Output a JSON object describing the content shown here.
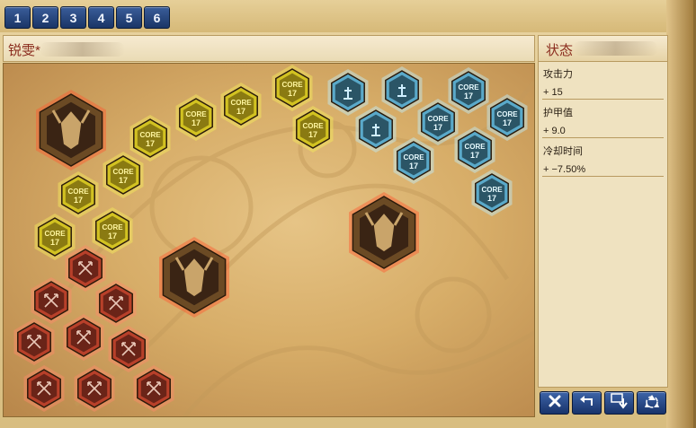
{
  "tabs": [
    "1",
    "2",
    "3",
    "4",
    "5",
    "6"
  ],
  "build": {
    "title": "锐雯*"
  },
  "stats": {
    "header": "状态",
    "items": [
      {
        "label": "攻击力",
        "value": "+ 15"
      },
      {
        "label": "护甲值",
        "value": "+ 9.0"
      },
      {
        "label": "冷却时间",
        "value": "+ −7.50%"
      }
    ]
  },
  "rune_label": {
    "line1": "CORE",
    "line2": "17"
  },
  "rune_colors": {
    "red": "#b8402a",
    "yellow": "#d2c221",
    "blue": "#5aa9c9",
    "gold": "#6b4a24"
  },
  "buttons": [
    {
      "icon": "close-x-icon"
    },
    {
      "icon": "undo-icon"
    },
    {
      "icon": "save-down-icon"
    },
    {
      "icon": "recycle-icon"
    }
  ]
}
